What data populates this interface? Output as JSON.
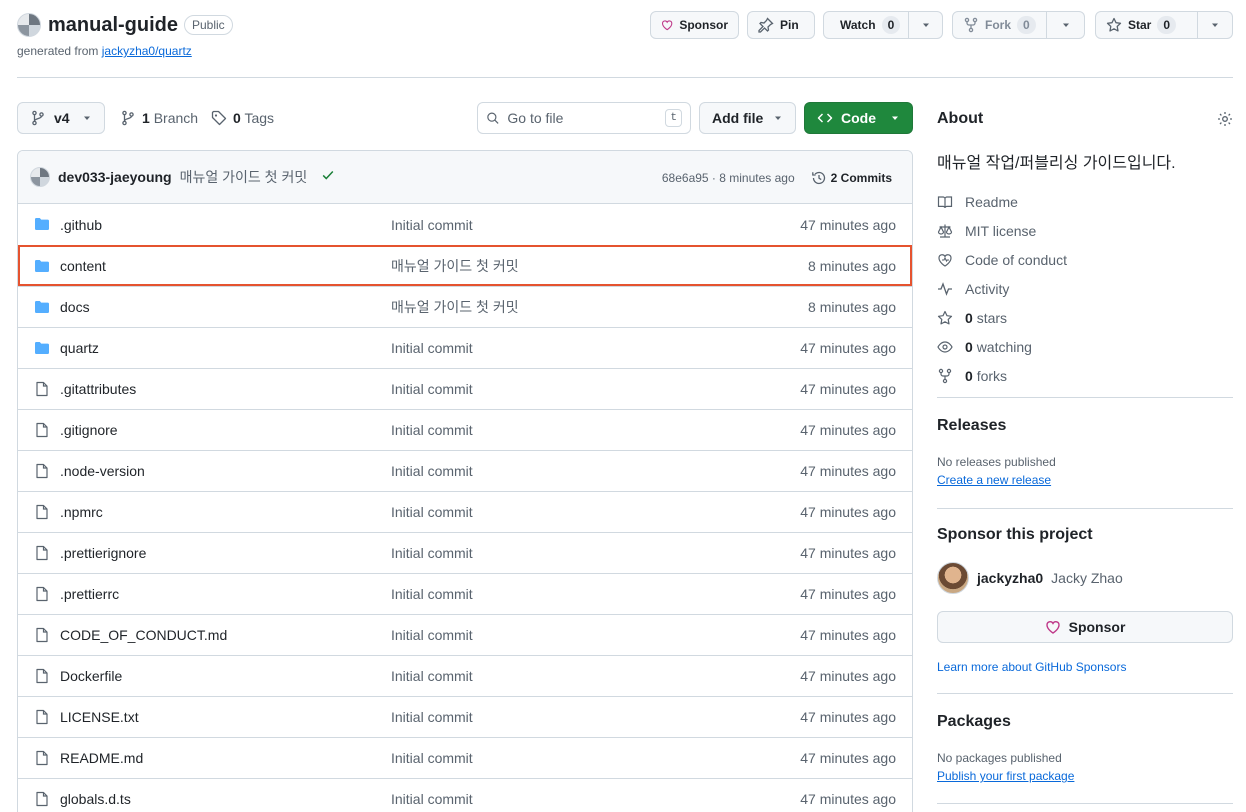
{
  "repo": {
    "name": "manual-guide",
    "visibility": "Public",
    "generated_prefix": "generated from",
    "generated_from": "jackyzha0/quartz"
  },
  "header_actions": {
    "sponsor": "Sponsor",
    "pin": "Pin",
    "watch": "Watch",
    "watch_count": "0",
    "fork": "Fork",
    "fork_count": "0",
    "star": "Star",
    "star_count": "0"
  },
  "toolbar": {
    "branch": "v4",
    "branch_count": "1",
    "branch_label": "Branch",
    "tag_count": "0",
    "tag_label": "Tags",
    "goto_placeholder": "Go to file",
    "goto_kbd": "t",
    "add_file": "Add file",
    "code": "Code"
  },
  "latest_commit": {
    "author": "dev033-jaeyoung",
    "message": "매뉴얼 가이드 첫 커밋",
    "hash_time": "68e6a95 · 8 minutes ago",
    "commits": "2 Commits"
  },
  "files": [
    {
      "name": ".github",
      "type": "dir",
      "message": "Initial commit",
      "time": "47 minutes ago"
    },
    {
      "name": "content",
      "type": "dir",
      "message": "매뉴얼 가이드 첫 커밋",
      "time": "8 minutes ago",
      "highlighted": true
    },
    {
      "name": "docs",
      "type": "dir",
      "message": "매뉴얼 가이드 첫 커밋",
      "time": "8 minutes ago"
    },
    {
      "name": "quartz",
      "type": "dir",
      "message": "Initial commit",
      "time": "47 minutes ago"
    },
    {
      "name": ".gitattributes",
      "type": "file",
      "message": "Initial commit",
      "time": "47 minutes ago"
    },
    {
      "name": ".gitignore",
      "type": "file",
      "message": "Initial commit",
      "time": "47 minutes ago"
    },
    {
      "name": ".node-version",
      "type": "file",
      "message": "Initial commit",
      "time": "47 minutes ago"
    },
    {
      "name": ".npmrc",
      "type": "file",
      "message": "Initial commit",
      "time": "47 minutes ago"
    },
    {
      "name": ".prettierignore",
      "type": "file",
      "message": "Initial commit",
      "time": "47 minutes ago"
    },
    {
      "name": ".prettierrc",
      "type": "file",
      "message": "Initial commit",
      "time": "47 minutes ago"
    },
    {
      "name": "CODE_OF_CONDUCT.md",
      "type": "file",
      "message": "Initial commit",
      "time": "47 minutes ago"
    },
    {
      "name": "Dockerfile",
      "type": "file",
      "message": "Initial commit",
      "time": "47 minutes ago"
    },
    {
      "name": "LICENSE.txt",
      "type": "file",
      "message": "Initial commit",
      "time": "47 minutes ago"
    },
    {
      "name": "README.md",
      "type": "file",
      "message": "Initial commit",
      "time": "47 minutes ago"
    },
    {
      "name": "globals.d.ts",
      "type": "file",
      "message": "Initial commit",
      "time": "47 minutes ago"
    }
  ],
  "about": {
    "title": "About",
    "description": "매뉴얼 작업/퍼블리싱 가이드입니다.",
    "readme": "Readme",
    "license": "MIT license",
    "conduct": "Code of conduct",
    "activity": "Activity",
    "stars_count": "0",
    "stars_label": "stars",
    "watching_count": "0",
    "watching_label": "watching",
    "forks_count": "0",
    "forks_label": "forks"
  },
  "releases": {
    "title": "Releases",
    "none": "No releases published",
    "create": "Create a new release"
  },
  "sponsor_project": {
    "title": "Sponsor this project",
    "username": "jackyzha0",
    "fullname": "Jacky Zhao",
    "button": "Sponsor",
    "learn_more": "Learn more about GitHub Sponsors"
  },
  "packages": {
    "title": "Packages",
    "none": "No packages published",
    "publish": "Publish your first package"
  },
  "colors": {
    "accent_blue": "#0969da",
    "code_green": "#1f883d",
    "folder_blue": "#54aeff",
    "highlight": "#e5532f",
    "sponsor_pink": "#bf3989"
  }
}
